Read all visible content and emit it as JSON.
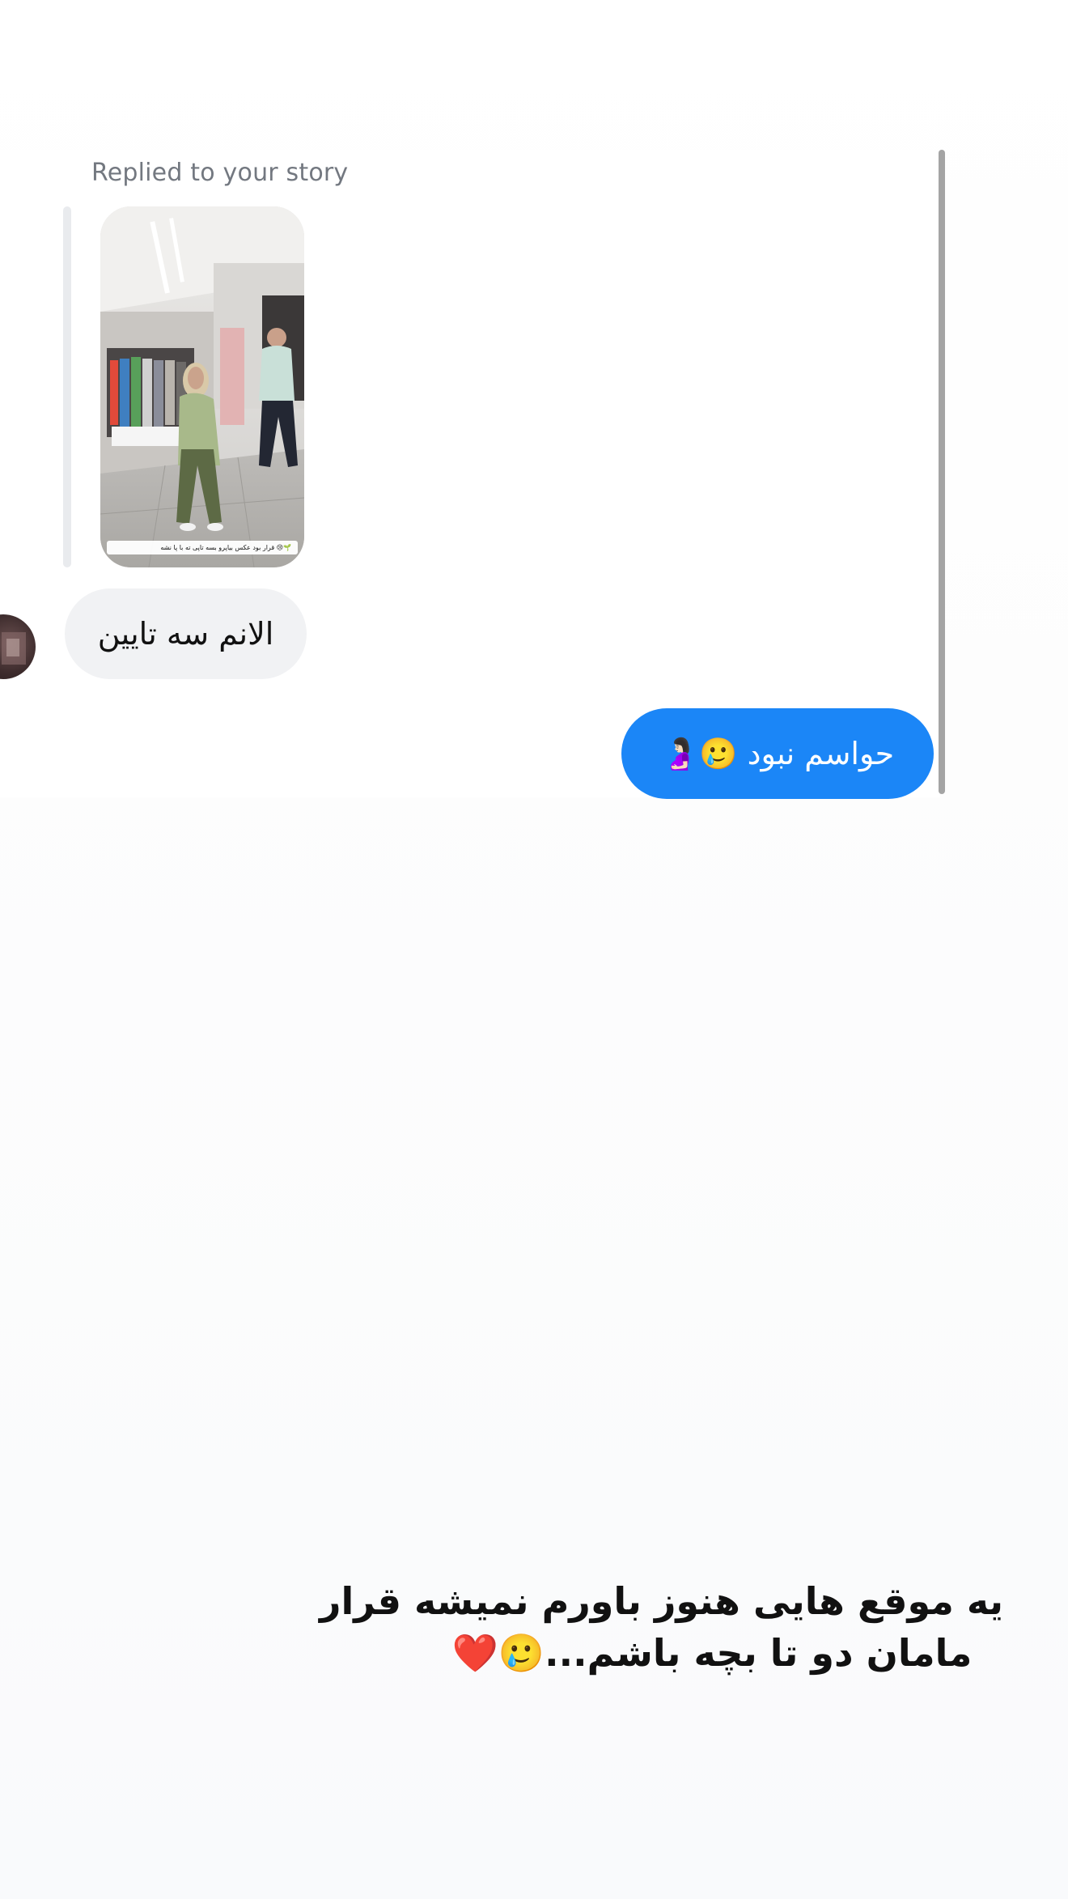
{
  "conversation": {
    "reply_label": "Replied to your story",
    "story_caption": "قرار بود عکس بیاپرو بسه تاپی ته با پا نشه 😢🌱",
    "messages": [
      {
        "direction": "incoming",
        "text": "الانم سه تایین"
      },
      {
        "direction": "outgoing",
        "text": "حواسم نبود 🥲🤰🏻"
      }
    ]
  },
  "overlay_caption": {
    "line1": "یه موقع هایی هنوز باورم نمیشه قرار",
    "line2": "مامان دو تا بچه باشم...🥲❤️"
  },
  "colors": {
    "outgoing_bubble": "#1b86f7",
    "incoming_bubble": "#f1f2f4",
    "reply_label": "#737880",
    "scrollbar": "#a4a4a4"
  }
}
